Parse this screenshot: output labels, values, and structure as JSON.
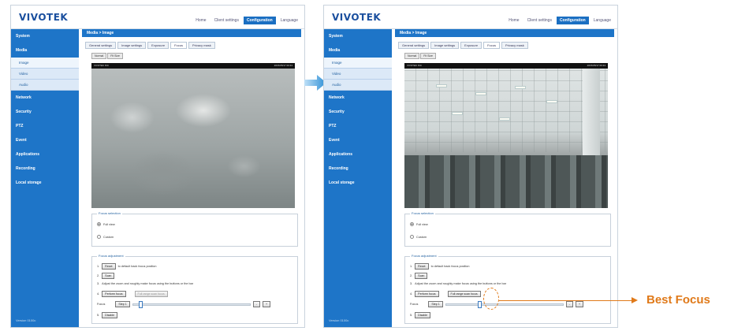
{
  "header": {
    "logo": "VIVOTEK",
    "nav": [
      "Home",
      "Client settings",
      "Configuration",
      "Language"
    ]
  },
  "sidebar": {
    "items": [
      "System",
      "Media",
      "Network",
      "Security",
      "PTZ",
      "Event",
      "Applications",
      "Recording",
      "Local storage"
    ],
    "media_sub": [
      "Image",
      "Video",
      "Audio"
    ],
    "footer": "Version 0100c"
  },
  "content": {
    "breadcrumb": "Media > Image",
    "tabs": [
      "General settings",
      "Image settings",
      "Exposure",
      "Focus",
      "Privacy mask"
    ],
    "view_modes": [
      "Normal",
      "Fit Size"
    ],
    "video_left_text": "VIVOTEK INC",
    "video_right_text": "2015/05/17 09:34"
  },
  "focus_selection": {
    "legend": "Focus selection",
    "options": [
      "Full view",
      "Custom"
    ]
  },
  "focus_adjustment": {
    "legend": "Focus adjustment",
    "step1_button": "Reset",
    "step1_text": "to default back focus position",
    "step2_button": "Scan",
    "step2_text": "",
    "step3_text": "Adjust the zoom and roughly make focus using the buttons or the bar",
    "step4_button": "Perform focus",
    "step4_button2": "Full range scan focus",
    "focus_label": "Focus",
    "focus_step_button": "Step 1",
    "step5_button": "Disable",
    "focus_left_level": 0.05,
    "focus_right_level": 0.27
  },
  "annotation": {
    "best_focus": "Best Focus"
  },
  "colors": {
    "brand_blue": "#1e75c8",
    "accent_orange": "#e07a1a"
  }
}
